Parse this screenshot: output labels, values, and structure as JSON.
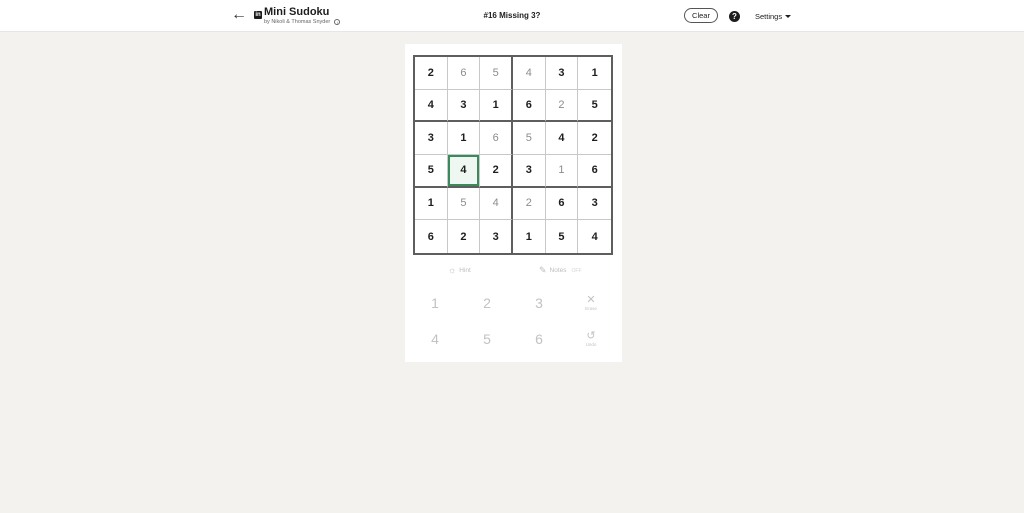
{
  "header": {
    "back_icon": "arrow-left-icon",
    "logo_text": "in",
    "app_title": "Mini Sudoku",
    "subtitle": "by Nikoli & Thomas Snyder",
    "info_icon_glyph": "i",
    "puzzle_title": "#16 Missing 3?",
    "clear_label": "Clear",
    "help_glyph": "?",
    "settings_label": "Settings"
  },
  "board": {
    "rows": [
      [
        {
          "v": "2",
          "given": false
        },
        {
          "v": "6",
          "given": true
        },
        {
          "v": "5",
          "given": true
        },
        {
          "v": "4",
          "given": true
        },
        {
          "v": "3",
          "given": false
        },
        {
          "v": "1",
          "given": false
        }
      ],
      [
        {
          "v": "4",
          "given": false
        },
        {
          "v": "3",
          "given": false
        },
        {
          "v": "1",
          "given": false
        },
        {
          "v": "6",
          "given": false
        },
        {
          "v": "2",
          "given": true
        },
        {
          "v": "5",
          "given": false
        }
      ],
      [
        {
          "v": "3",
          "given": false
        },
        {
          "v": "1",
          "given": false
        },
        {
          "v": "6",
          "given": true
        },
        {
          "v": "5",
          "given": true
        },
        {
          "v": "4",
          "given": false
        },
        {
          "v": "2",
          "given": false
        }
      ],
      [
        {
          "v": "5",
          "given": false
        },
        {
          "v": "4",
          "given": false,
          "selected": true
        },
        {
          "v": "2",
          "given": false
        },
        {
          "v": "3",
          "given": false
        },
        {
          "v": "1",
          "given": true
        },
        {
          "v": "6",
          "given": false
        }
      ],
      [
        {
          "v": "1",
          "given": false
        },
        {
          "v": "5",
          "given": true
        },
        {
          "v": "4",
          "given": true
        },
        {
          "v": "2",
          "given": true
        },
        {
          "v": "6",
          "given": false
        },
        {
          "v": "3",
          "given": false
        }
      ],
      [
        {
          "v": "6",
          "given": false
        },
        {
          "v": "2",
          "given": false
        },
        {
          "v": "3",
          "given": false
        },
        {
          "v": "1",
          "given": false
        },
        {
          "v": "5",
          "given": false
        },
        {
          "v": "4",
          "given": false
        }
      ]
    ],
    "selected_color": "#3b8a5c"
  },
  "tools": {
    "hint_label": "Hint",
    "notes_label": "Notes",
    "notes_state": "OFF"
  },
  "keypad": {
    "keys": [
      "1",
      "2",
      "3",
      "4",
      "5",
      "6"
    ],
    "erase_label": "Erase",
    "undo_label": "Undo"
  }
}
